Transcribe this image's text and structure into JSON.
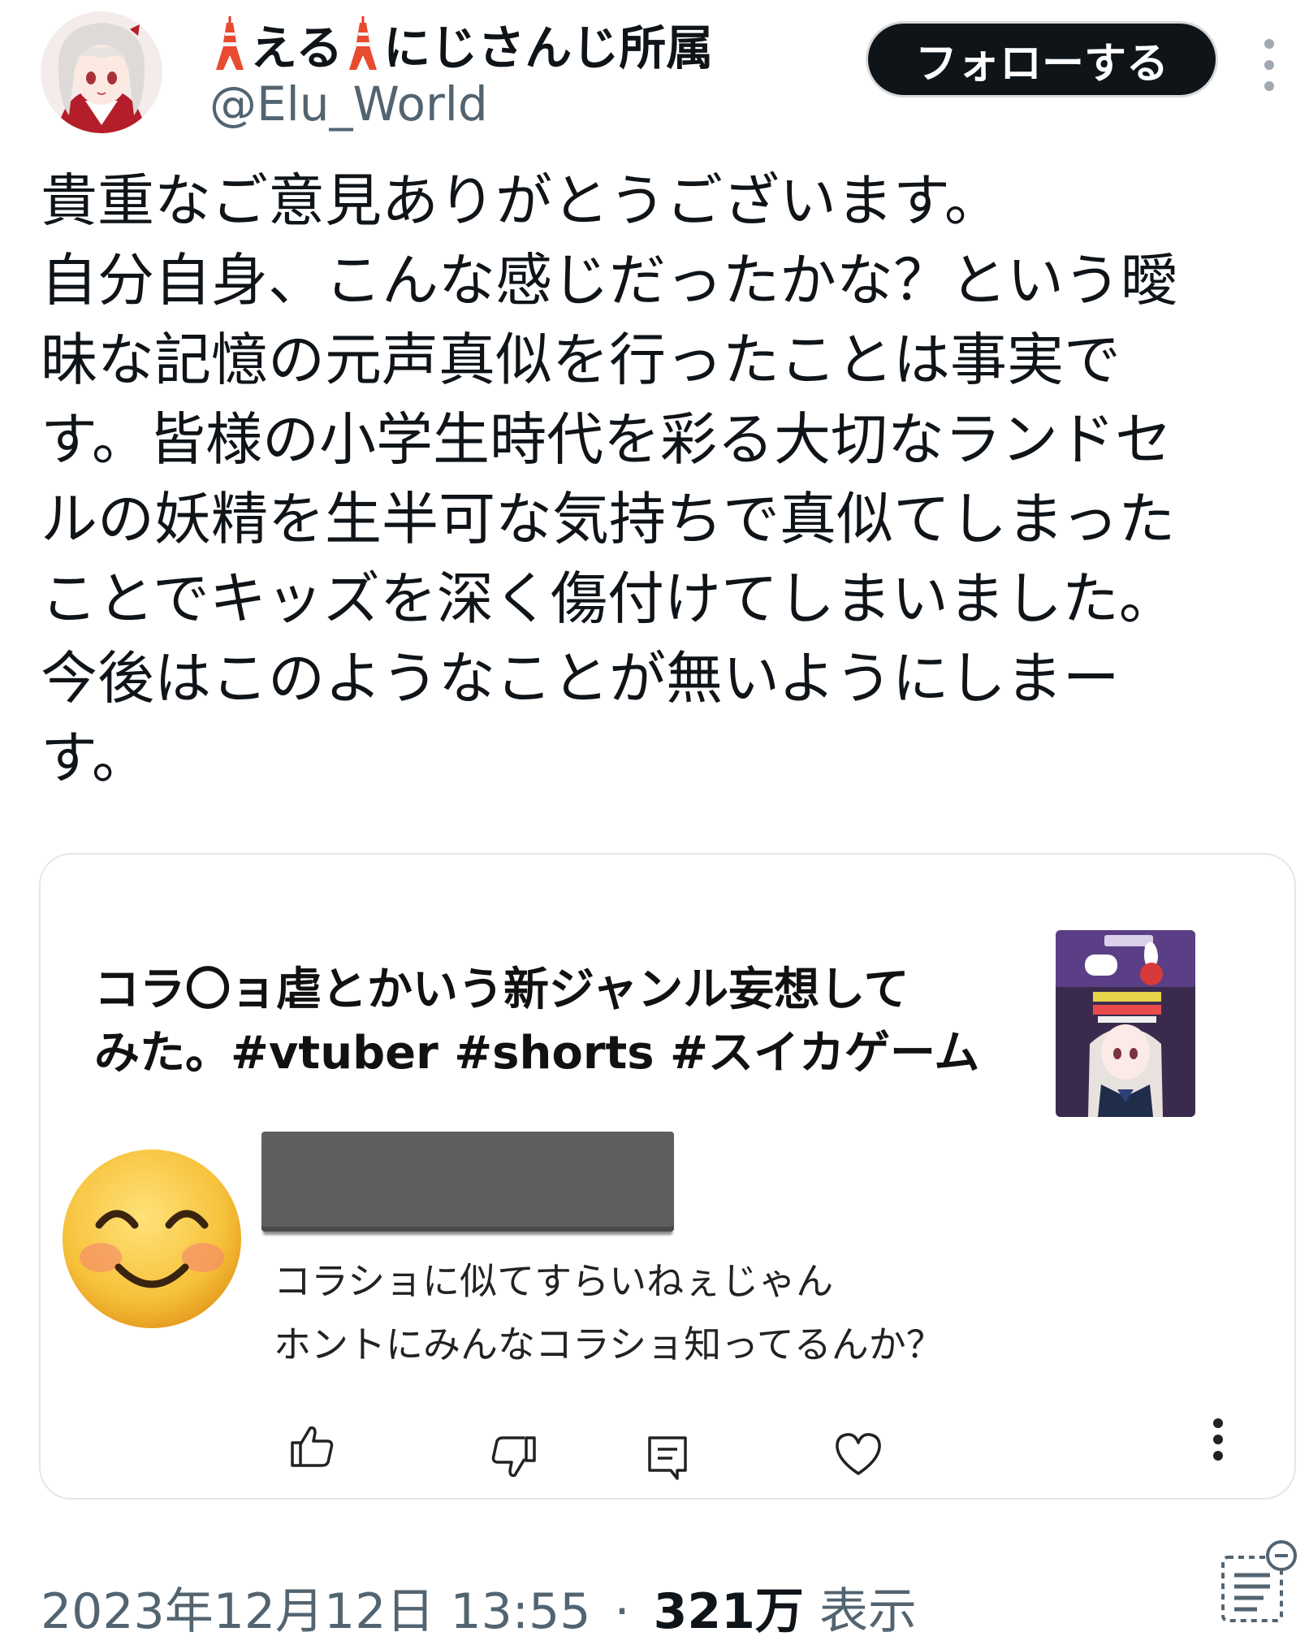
{
  "author": {
    "avatar_icon": "anime-girl-avatar",
    "name_prefix_icon": "tokyo-tower-icon",
    "name_part1": "える",
    "name_part2": "にじさんじ所属",
    "handle": "@Elu_World"
  },
  "follow_label": "フォローする",
  "more_icon": "more-vertical-icon",
  "tweet_lines": [
    "貴重なご意見ありがとうございます。",
    "自分自身、こんな感じだったかな？という曖",
    "昧な記憶の元声真似を行ったことは事実で",
    "す。皆様の小学生時代を彩る大切なランドセ",
    "ルの妖精を生半可な気持ちで真似てしまった",
    "ことでキッズを深く傷付けてしまいました。",
    "今後はこのようなことが無いようにしまー",
    "す。"
  ],
  "embed": {
    "title_lines": [
      "コラ〇ョ虐とかいう新ジャンル妄想して",
      "みた。#vtuber #shorts #スイカゲーム"
    ],
    "thumbnail_icon": "video-thumbnail",
    "commenter_icon": "smiling-face-emoji",
    "comment_lines": [
      "コラショに似てすらいねぇじゃん",
      "ホントにみんなコラショ知ってるんか？"
    ],
    "actions": {
      "like_icon": "thumbs-up-icon",
      "dislike_icon": "thumbs-down-icon",
      "reply_icon": "comment-icon",
      "heart_icon": "heart-icon",
      "more_icon": "more-vertical-icon"
    }
  },
  "footer": {
    "timestamp": "2023年12月12日 13:55",
    "separator": "·",
    "views_count": "321万",
    "views_label": "表示",
    "list_icon": "translate-list-icon"
  },
  "colors": {
    "text": "#0f1419",
    "secondary": "#536471",
    "follow_bg": "#0f1419",
    "card_border": "#e3e6e8",
    "redaction": "#5f5f62"
  }
}
